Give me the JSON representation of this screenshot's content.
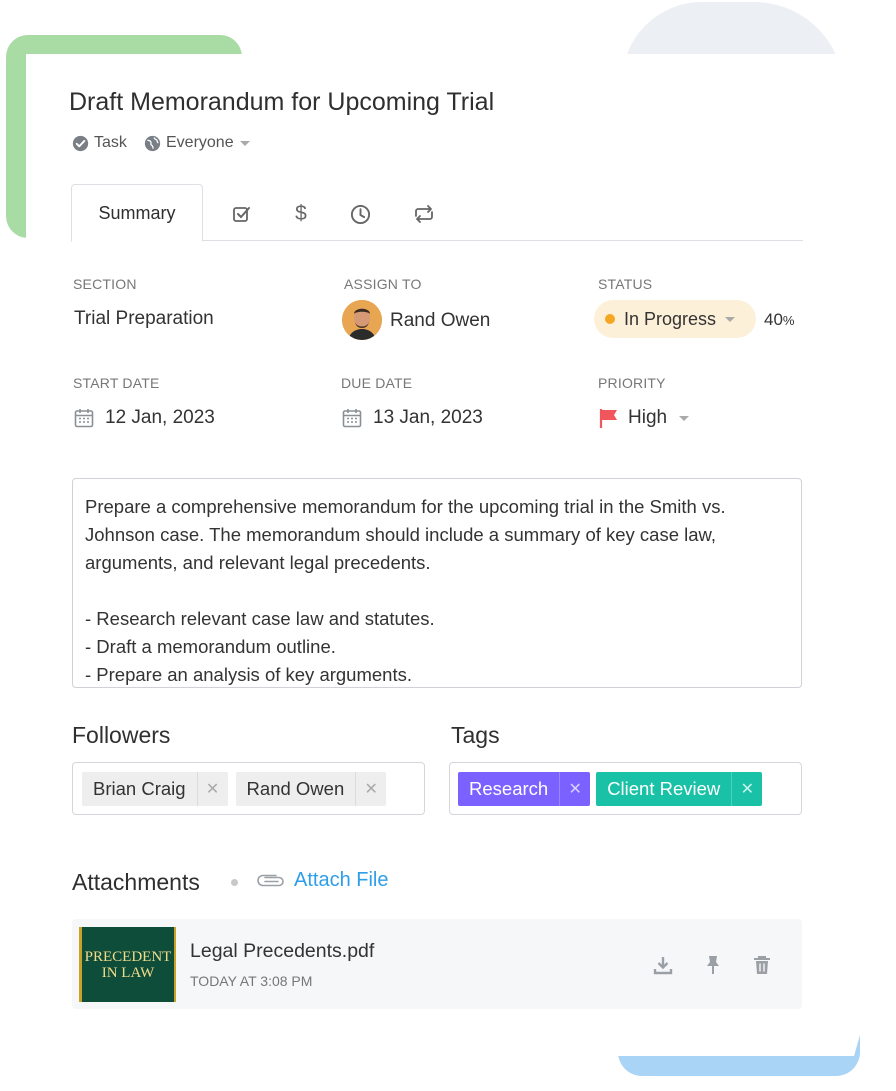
{
  "task": {
    "title": "Draft Memorandum for Upcoming Trial",
    "type_label": "Task",
    "visibility_label": "Everyone"
  },
  "tabs": [
    {
      "label": "Summary",
      "active": true
    },
    {
      "icon": "checkbox-icon"
    },
    {
      "icon": "dollar-icon"
    },
    {
      "icon": "clock-icon"
    },
    {
      "icon": "repeat-icon"
    }
  ],
  "fields": {
    "section": {
      "label": "SECTION",
      "value": "Trial Preparation"
    },
    "assign_to": {
      "label": "ASSIGN TO",
      "value": "Rand Owen"
    },
    "status": {
      "label": "STATUS",
      "value": "In Progress",
      "progress_value": "40",
      "progress_unit": "%",
      "color": "#f5a623"
    },
    "start_date": {
      "label": "START DATE",
      "value": "12 Jan, 2023"
    },
    "due_date": {
      "label": "DUE DATE",
      "value": "13 Jan, 2023"
    },
    "priority": {
      "label": "PRIORITY",
      "value": "High",
      "color": "#f0565b"
    }
  },
  "description": {
    "lines": [
      "Prepare a comprehensive memorandum for the upcoming trial in the Smith vs.",
      "Johnson case. The memorandum should include a summary of key case law,",
      "arguments, and relevant legal precedents.",
      "",
      "- Research relevant case law and statutes.",
      "- Draft a memorandum outline.",
      "- Prepare an analysis of key arguments."
    ]
  },
  "followers": {
    "title": "Followers",
    "items": [
      "Brian Craig",
      "Rand Owen"
    ]
  },
  "tags": {
    "title": "Tags",
    "items": [
      {
        "label": "Research",
        "color": "#7b61ff"
      },
      {
        "label": "Client Review",
        "color": "#19c2a6"
      }
    ]
  },
  "attachments": {
    "title": "Attachments",
    "attach_label": "Attach File",
    "files": [
      {
        "name": "Legal Precedents.pdf",
        "time": "TODAY AT 3:08 PM",
        "thumb_line1": "PRECEDENT",
        "thumb_line2": "IN LAW"
      }
    ]
  }
}
